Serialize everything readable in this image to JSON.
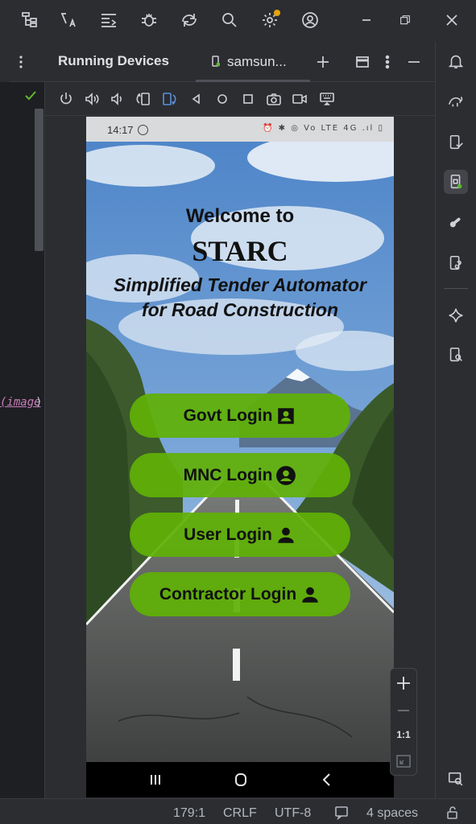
{
  "title_bar": {
    "icons": [
      "project-structure-icon",
      "translate-icon",
      "format-icon",
      "debug-bug-icon",
      "device-sync-icon",
      "search-icon",
      "settings-gear-icon",
      "account-icon",
      "minimize-icon",
      "restore-icon",
      "close-icon"
    ]
  },
  "editor": {
    "code_fragment": "(image",
    "code_close": ")"
  },
  "panel": {
    "title": "Running Devices",
    "tab_label": "samsun...",
    "tab_status_color": "#5fb832"
  },
  "device_toolbar": {
    "icons": [
      "power-icon",
      "volume-up-icon",
      "volume-down-icon",
      "rotate-left-icon",
      "rotate-right-icon",
      "back-icon",
      "home-icon",
      "overview-icon",
      "screenshot-icon",
      "screen-record-icon",
      "keyboard-icon"
    ]
  },
  "phone": {
    "status": {
      "time": "14:17",
      "icons_text": "⏰ ✱ ◎ Vo LTE 4G .ıl ▯"
    },
    "welcome": "Welcome to",
    "app_name": "STARC",
    "tagline_line1": "Simplified Tender Automator",
    "tagline_line2": "for Road Construction",
    "buttons": [
      {
        "label": "Govt Login",
        "icon": "id-card-icon"
      },
      {
        "label": "MNC Login",
        "icon": "account-circle-icon"
      },
      {
        "label": "User Login",
        "icon": "person-icon"
      },
      {
        "label": "Contractor Login",
        "icon": "person-icon"
      }
    ],
    "button_color": "#60b006"
  },
  "zoom": {
    "one_to_one": "1:1"
  },
  "status_bar": {
    "position": "179:1",
    "line_ending": "CRLF",
    "encoding": "UTF-8",
    "indent": "4 spaces"
  },
  "colors": {
    "ide_background": "#1e1f22",
    "ide_panel": "#2b2d30",
    "accent_green": "#5fb832"
  }
}
